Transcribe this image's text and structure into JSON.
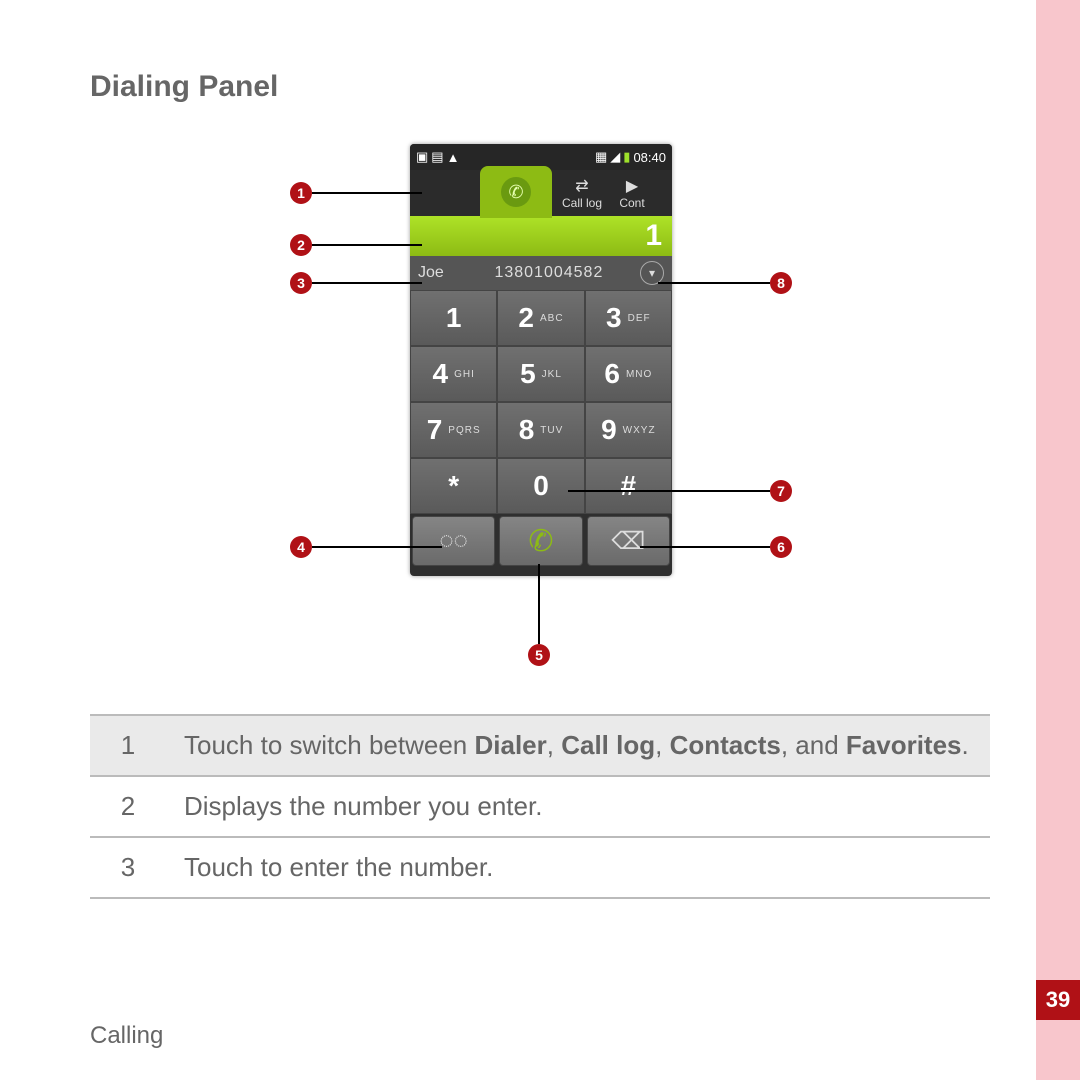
{
  "page": {
    "title": "Dialing Panel",
    "footer": "Calling",
    "number": "39"
  },
  "phone": {
    "status": {
      "time": "08:40"
    },
    "tabs": {
      "call_log": "Call log",
      "contacts": "Cont"
    },
    "entered_number": "1",
    "suggest": {
      "name": "Joe",
      "number": "13801004582"
    },
    "keys": {
      "k1": "1",
      "k2": "2",
      "k2l": "ABC",
      "k3": "3",
      "k3l": "DEF",
      "k4": "4",
      "k4l": "GHI",
      "k5": "5",
      "k5l": "JKL",
      "k6": "6",
      "k6l": "MNO",
      "k7": "7",
      "k7l": "PQRS",
      "k8": "8",
      "k8l": "TUV",
      "k9": "9",
      "k9l": "WXYZ",
      "kstar": "*",
      "k0": "0",
      "khash": "#"
    },
    "actions": {
      "voicemail": "◌◌",
      "call": "✆",
      "backspace": "⌫"
    }
  },
  "callouts": {
    "c1": "1",
    "c2": "2",
    "c3": "3",
    "c4": "4",
    "c5": "5",
    "c6": "6",
    "c7": "7",
    "c8": "8"
  },
  "table": {
    "r1num": "1",
    "r1a": "Touch to switch between ",
    "r1b": "Dialer",
    "r1c": ", ",
    "r1d": "Call log",
    "r1e": ", ",
    "r1f": "Contacts",
    "r1g": ", and ",
    "r1h": "Favorites",
    "r1i": ".",
    "r2num": "2",
    "r2text": "Displays the number you enter.",
    "r3num": "3",
    "r3text": "Touch to enter the number."
  }
}
